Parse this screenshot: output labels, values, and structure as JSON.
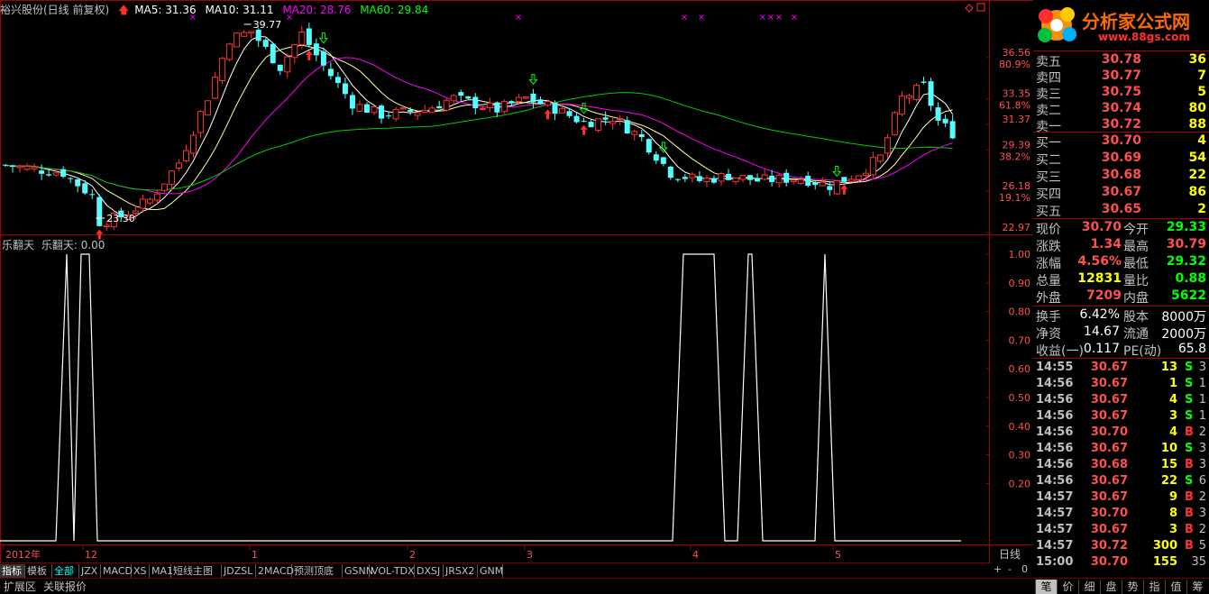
{
  "stock_title": "裕兴股份(日线 前复权)",
  "ma_legend": [
    {
      "label": "MA5: 31.36",
      "color": "#ffffff"
    },
    {
      "label": "MA10: 31.11",
      "color": "#ffffff"
    },
    {
      "label": "MA20: 28.76",
      "color": "#ff00ff"
    },
    {
      "label": "MA60: 29.84",
      "color": "#00ff00"
    }
  ],
  "indicator_legend": {
    "name": "乐翻天",
    "value_label": "乐翻天: 0.00"
  },
  "high_marker": "39.77",
  "low_marker": "23.30",
  "period_label": "日线",
  "price_axis": [
    {
      "price": "36.56",
      "pct": "80.9%"
    },
    {
      "price": "33.35",
      "pct": "61.8%"
    },
    {
      "price": "31.37",
      "pct": ""
    },
    {
      "price": "29.39",
      "pct": "38.2%"
    },
    {
      "price": "26.18",
      "pct": "19.1%"
    },
    {
      "price": "22.97",
      "pct": ""
    }
  ],
  "indicator_axis": [
    "1.00",
    "0.90",
    "0.80",
    "0.70",
    "0.60",
    "0.50",
    "0.40",
    "0.30",
    "0.20"
  ],
  "time_axis": [
    "2012年",
    "12",
    "1",
    "2",
    "3",
    "4",
    "5"
  ],
  "chart_data": {
    "type": "line",
    "indicator": {
      "name": "乐翻天",
      "segments": [
        {
          "start": 62,
          "end": 108,
          "kind": "spike2"
        },
        {
          "start": 746,
          "end": 804,
          "kind": "plateau"
        },
        {
          "start": 818,
          "end": 846,
          "kind": "plateau"
        },
        {
          "start": 904,
          "end": 926,
          "kind": "spike"
        }
      ],
      "ylim": [
        0,
        1
      ]
    },
    "ylim": [
      22.97,
      39.77
    ]
  },
  "sidebar": {
    "logo": "分析家公式网",
    "logo_url": "www.88gs.com",
    "asks": [
      {
        "label": "卖五",
        "price": "30.78",
        "vol": "36"
      },
      {
        "label": "卖四",
        "price": "30.77",
        "vol": "7"
      },
      {
        "label": "卖三",
        "price": "30.75",
        "vol": "5"
      },
      {
        "label": "卖二",
        "price": "30.74",
        "vol": "80"
      },
      {
        "label": "卖一",
        "price": "30.72",
        "vol": "88"
      }
    ],
    "bids": [
      {
        "label": "买一",
        "price": "30.70",
        "vol": "4"
      },
      {
        "label": "买二",
        "price": "30.69",
        "vol": "54"
      },
      {
        "label": "买三",
        "price": "30.68",
        "vol": "22"
      },
      {
        "label": "买四",
        "price": "30.67",
        "vol": "86"
      },
      {
        "label": "买五",
        "price": "30.65",
        "vol": "2"
      }
    ],
    "quote": [
      {
        "k1": "现价",
        "v1": "30.70",
        "c1": "#ff5050",
        "k2": "今开",
        "v2": "29.33",
        "c2": "#00ff00"
      },
      {
        "k1": "涨跌",
        "v1": "1.34",
        "c1": "#ff5050",
        "k2": "最高",
        "v2": "30.79",
        "c2": "#ff5050"
      },
      {
        "k1": "涨幅",
        "v1": "4.56%",
        "c1": "#ff5050",
        "k2": "最低",
        "v2": "29.32",
        "c2": "#00ff00"
      },
      {
        "k1": "总量",
        "v1": "12831",
        "c1": "#ffff00",
        "k2": "量比",
        "v2": "0.88",
        "c2": "#00ff00"
      },
      {
        "k1": "外盘",
        "v1": "7209",
        "c1": "#ff5050",
        "k2": "内盘",
        "v2": "5622",
        "c2": "#00ff00"
      }
    ],
    "fund": [
      {
        "k1": "换手",
        "v1": "6.42%",
        "k2": "股本",
        "v2": "8000万"
      },
      {
        "k1": "净资",
        "v1": "14.67",
        "k2": "流通",
        "v2": "2000万"
      },
      {
        "k1": "收益(一)",
        "v1": "0.117",
        "k2": "PE(动)",
        "v2": "65.8"
      }
    ],
    "ticks": [
      {
        "t": "14:55",
        "p": "30.67",
        "v": "13",
        "s": "S",
        "n": "3"
      },
      {
        "t": "14:56",
        "p": "30.67",
        "v": "1",
        "s": "S",
        "n": "1"
      },
      {
        "t": "14:56",
        "p": "30.67",
        "v": "4",
        "s": "S",
        "n": "1"
      },
      {
        "t": "14:56",
        "p": "30.67",
        "v": "3",
        "s": "S",
        "n": "1"
      },
      {
        "t": "14:56",
        "p": "30.70",
        "v": "4",
        "s": "B",
        "n": "2"
      },
      {
        "t": "14:56",
        "p": "30.67",
        "v": "10",
        "s": "S",
        "n": "3"
      },
      {
        "t": "14:56",
        "p": "30.68",
        "v": "15",
        "s": "B",
        "n": "3"
      },
      {
        "t": "14:56",
        "p": "30.67",
        "v": "22",
        "s": "S",
        "n": "6"
      },
      {
        "t": "14:57",
        "p": "30.67",
        "v": "9",
        "s": "B",
        "n": "2"
      },
      {
        "t": "14:57",
        "p": "30.70",
        "v": "8",
        "s": "B",
        "n": "3"
      },
      {
        "t": "14:57",
        "p": "30.67",
        "v": "3",
        "s": "B",
        "n": "2"
      },
      {
        "t": "14:57",
        "p": "30.72",
        "v": "300",
        "s": "B",
        "n": "5"
      },
      {
        "t": "15:00",
        "p": "30.70",
        "v": "155",
        "s": "",
        "n": "35"
      }
    ]
  },
  "indicator_tabs": [
    "指标",
    "模板",
    "全部",
    "JZX",
    "MACD",
    "XS",
    "MA1",
    "短线主图",
    "JDZSL",
    "2MACD",
    "预测顶底",
    "GSNN",
    "VOL-TDX",
    "DXSJ",
    "JRSX2",
    "GNM"
  ],
  "zoom_controls": [
    "+",
    "-",
    "0"
  ],
  "bottom_tabs": [
    "扩展区",
    "关联报价"
  ],
  "right_tabs": [
    "笔",
    "价",
    "细",
    "盘",
    "势",
    "指",
    "值",
    "筹"
  ]
}
